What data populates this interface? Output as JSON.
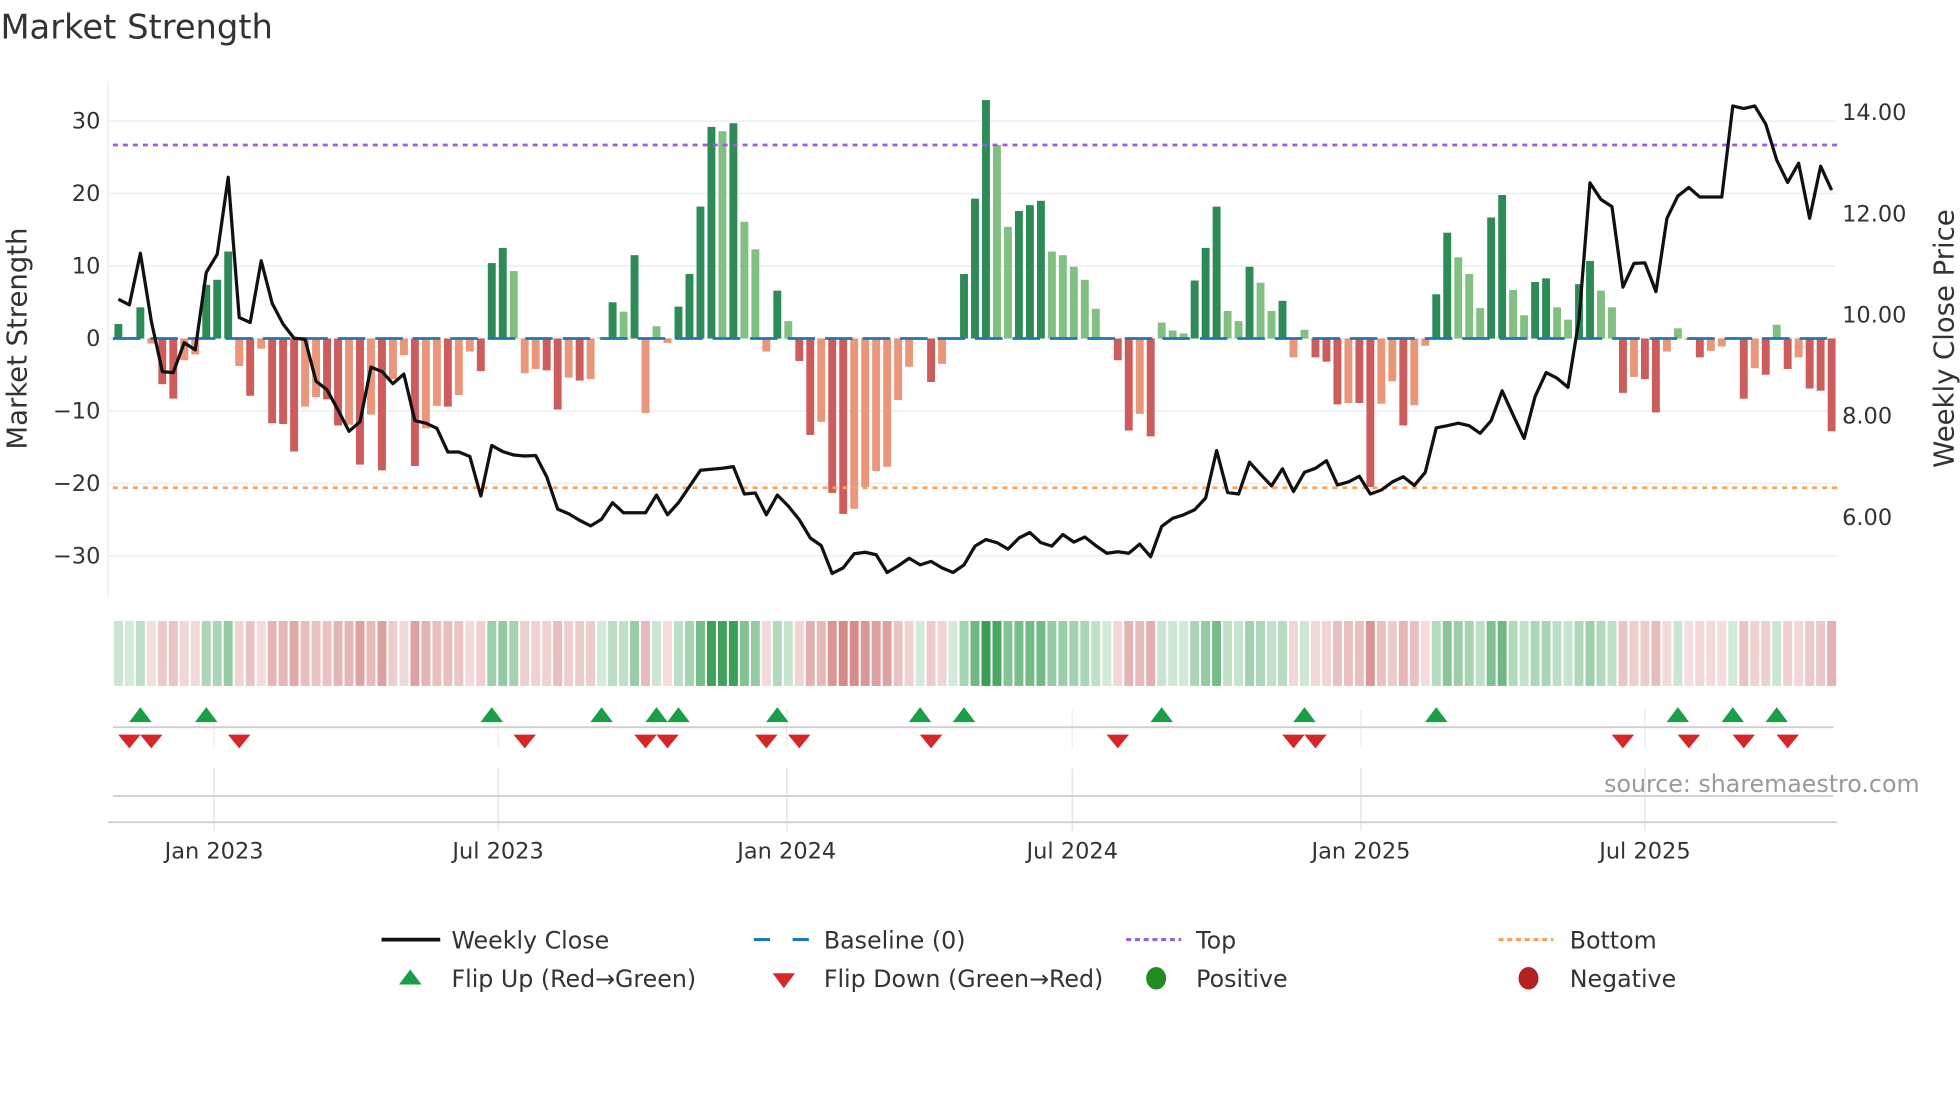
{
  "title": "Market Strength",
  "source": "source: sharemaestro.com",
  "legend": {
    "weekly_close": "Weekly Close",
    "baseline": "Baseline (0)",
    "top": "Top",
    "bottom": "Bottom",
    "flip_up": "Flip Up (Red→Green)",
    "flip_down": "Flip Down (Green→Red)",
    "positive": "Positive",
    "negative": "Negative"
  },
  "colors": {
    "pos_strong": "#2e8b57",
    "pos_weak": "#82c082",
    "neg_strong": "#cd5c5c",
    "neg_weak": "#e9967a",
    "top_line": "#9b5fd6",
    "bottom_line": "#f4a460",
    "baseline": "#1f77b4",
    "flip_up": "#1a9e48",
    "flip_down": "#d62728",
    "positive_dot": "#228b22",
    "negative_dot": "#b22222",
    "price_line": "#111111"
  },
  "chart_data": {
    "type": "bar+line",
    "title": "Market Strength",
    "ylabel": "Market Strength",
    "y2label": "Weekly Close Price",
    "ylim": [
      -35.7,
      35.5
    ],
    "y2lim": [
      4.42,
      14.62
    ],
    "yticks": [
      "−30",
      "−20",
      "−10",
      "0",
      "10",
      "20",
      "30"
    ],
    "ytick_values": [
      -30,
      -20,
      -10,
      0,
      10,
      20,
      30
    ],
    "y2ticks": [
      "6.00",
      "8.00",
      "10.00",
      "12.00",
      "14.00"
    ],
    "y2tick_values": [
      6,
      8,
      10,
      12,
      14
    ],
    "xticks": [
      "Jan 2023",
      "Jul 2023",
      "Jan 2024",
      "Jul 2024",
      "Jan 2025",
      "Jul 2025"
    ],
    "xtick_dates": [
      "2023-01-01",
      "2023-07-01",
      "2024-01-01",
      "2024-07-01",
      "2025-01-01",
      "2025-07-01"
    ],
    "start_week": "2022-11-01",
    "frequency": "weekly",
    "top_level": 26.7,
    "bottom_level": -20.6,
    "grid": true,
    "legend_position": "bottom",
    "strength": [
      2,
      0.2,
      4.3,
      -0.7,
      -6.3,
      -8.3,
      -3,
      -2.2,
      7.4,
      8.1,
      12,
      -3.8,
      -7.9,
      -1.4,
      -11.7,
      -11.8,
      -15.6,
      -9.4,
      -8.1,
      -8.4,
      -12,
      -11.9,
      -17.4,
      -10.5,
      -18.2,
      -5.6,
      -2.3,
      -17.6,
      -12.4,
      -9.3,
      -9.4,
      -7.8,
      -1.8,
      -4.5,
      10.4,
      12.5,
      9.3,
      -4.8,
      -4.2,
      -4.4,
      -9.8,
      -5.4,
      -5.8,
      -5.6,
      0.1,
      5,
      3.7,
      11.5,
      -10.3,
      1.7,
      -0.6,
      4.4,
      8.9,
      18.2,
      29.2,
      28.6,
      29.7,
      16.1,
      12.3,
      -1.8,
      6.6,
      2.4,
      -3.1,
      -13.3,
      -11.5,
      -21.3,
      -24.2,
      -23.5,
      -20.5,
      -18.3,
      -17.7,
      -8.5,
      -3.9,
      0,
      -6,
      -3.5,
      0.1,
      8.9,
      19.3,
      32.9,
      26.7,
      15.4,
      17.6,
      18.4,
      19,
      12,
      11.5,
      9.9,
      8.1,
      4.1,
      0.1,
      -3,
      -12.7,
      -10.4,
      -13.5,
      2.2,
      1.1,
      0.7,
      8,
      12.5,
      18.2,
      3.8,
      2.4,
      9.9,
      7.7,
      3.8,
      5.2,
      -2.6,
      1.2,
      -2.6,
      -3.2,
      -9.1,
      -8.9,
      -8.9,
      -20.5,
      -9,
      -5.9,
      -12,
      -9.2,
      -1,
      6.1,
      14.6,
      11.2,
      8.9,
      4.2,
      16.7,
      19.8,
      6.7,
      3.2,
      7.8,
      8.3,
      4.3,
      2.6,
      7.5,
      10.7,
      6.6,
      4.3,
      -7.5,
      -5.3,
      -5.6,
      -10.2,
      -1.8,
      1.4,
      -0.2,
      -2.6,
      -1.7,
      -1.1,
      0.2,
      -8.3,
      -4.1,
      -5,
      1.9,
      -4.2,
      -2.6,
      -6.9,
      -7.2,
      -12.8
    ],
    "weekly_close": [
      10.31,
      10.2,
      11.22,
      9.87,
      8.88,
      8.86,
      9.45,
      9.31,
      10.84,
      11.2,
      12.72,
      9.95,
      9.85,
      11.07,
      10.23,
      9.82,
      9.54,
      9.52,
      8.69,
      8.52,
      8.12,
      7.7,
      7.89,
      8.97,
      8.88,
      8.64,
      8.83,
      7.91,
      7.86,
      7.76,
      7.29,
      7.29,
      7.2,
      6.42,
      7.42,
      7.3,
      7.23,
      7.21,
      7.22,
      6.8,
      6.16,
      6.07,
      5.94,
      5.83,
      5.96,
      6.29,
      6.09,
      6.09,
      6.09,
      6.44,
      6.05,
      6.29,
      6.61,
      6.93,
      6.95,
      6.97,
      7.0,
      6.46,
      6.48,
      6.05,
      6.44,
      6.22,
      5.95,
      5.59,
      5.44,
      4.89,
      5.0,
      5.28,
      5.31,
      5.26,
      4.91,
      5.04,
      5.19,
      5.06,
      5.13,
      5.0,
      4.91,
      5.06,
      5.43,
      5.56,
      5.5,
      5.37,
      5.59,
      5.7,
      5.5,
      5.43,
      5.66,
      5.51,
      5.61,
      5.44,
      5.29,
      5.32,
      5.29,
      5.47,
      5.22,
      5.82,
      5.98,
      6.05,
      6.15,
      6.38,
      7.32,
      6.49,
      6.46,
      7.09,
      6.85,
      6.62,
      6.96,
      6.51,
      6.89,
      6.97,
      7.12,
      6.64,
      6.7,
      6.81,
      6.46,
      6.54,
      6.7,
      6.8,
      6.63,
      6.89,
      7.77,
      7.81,
      7.86,
      7.81,
      7.66,
      7.91,
      8.5,
      8.02,
      7.56,
      8.39,
      8.86,
      8.75,
      8.57,
      9.9,
      12.61,
      12.28,
      12.14,
      10.55,
      11.02,
      11.03,
      10.46,
      11.91,
      12.35,
      12.52,
      12.33,
      12.33,
      12.33,
      14.13,
      14.08,
      14.13,
      13.77,
      13.06,
      12.62,
      13.0,
      11.91,
      12.94,
      12.47
    ],
    "flip_up_weeks": [
      2,
      8,
      34,
      44,
      49,
      51,
      60,
      73,
      77,
      95,
      108,
      120,
      142,
      147,
      151
    ],
    "flip_down_weeks": [
      1,
      3,
      11,
      37,
      48,
      50,
      59,
      62,
      74,
      91,
      107,
      109,
      137,
      143,
      148,
      152
    ]
  }
}
